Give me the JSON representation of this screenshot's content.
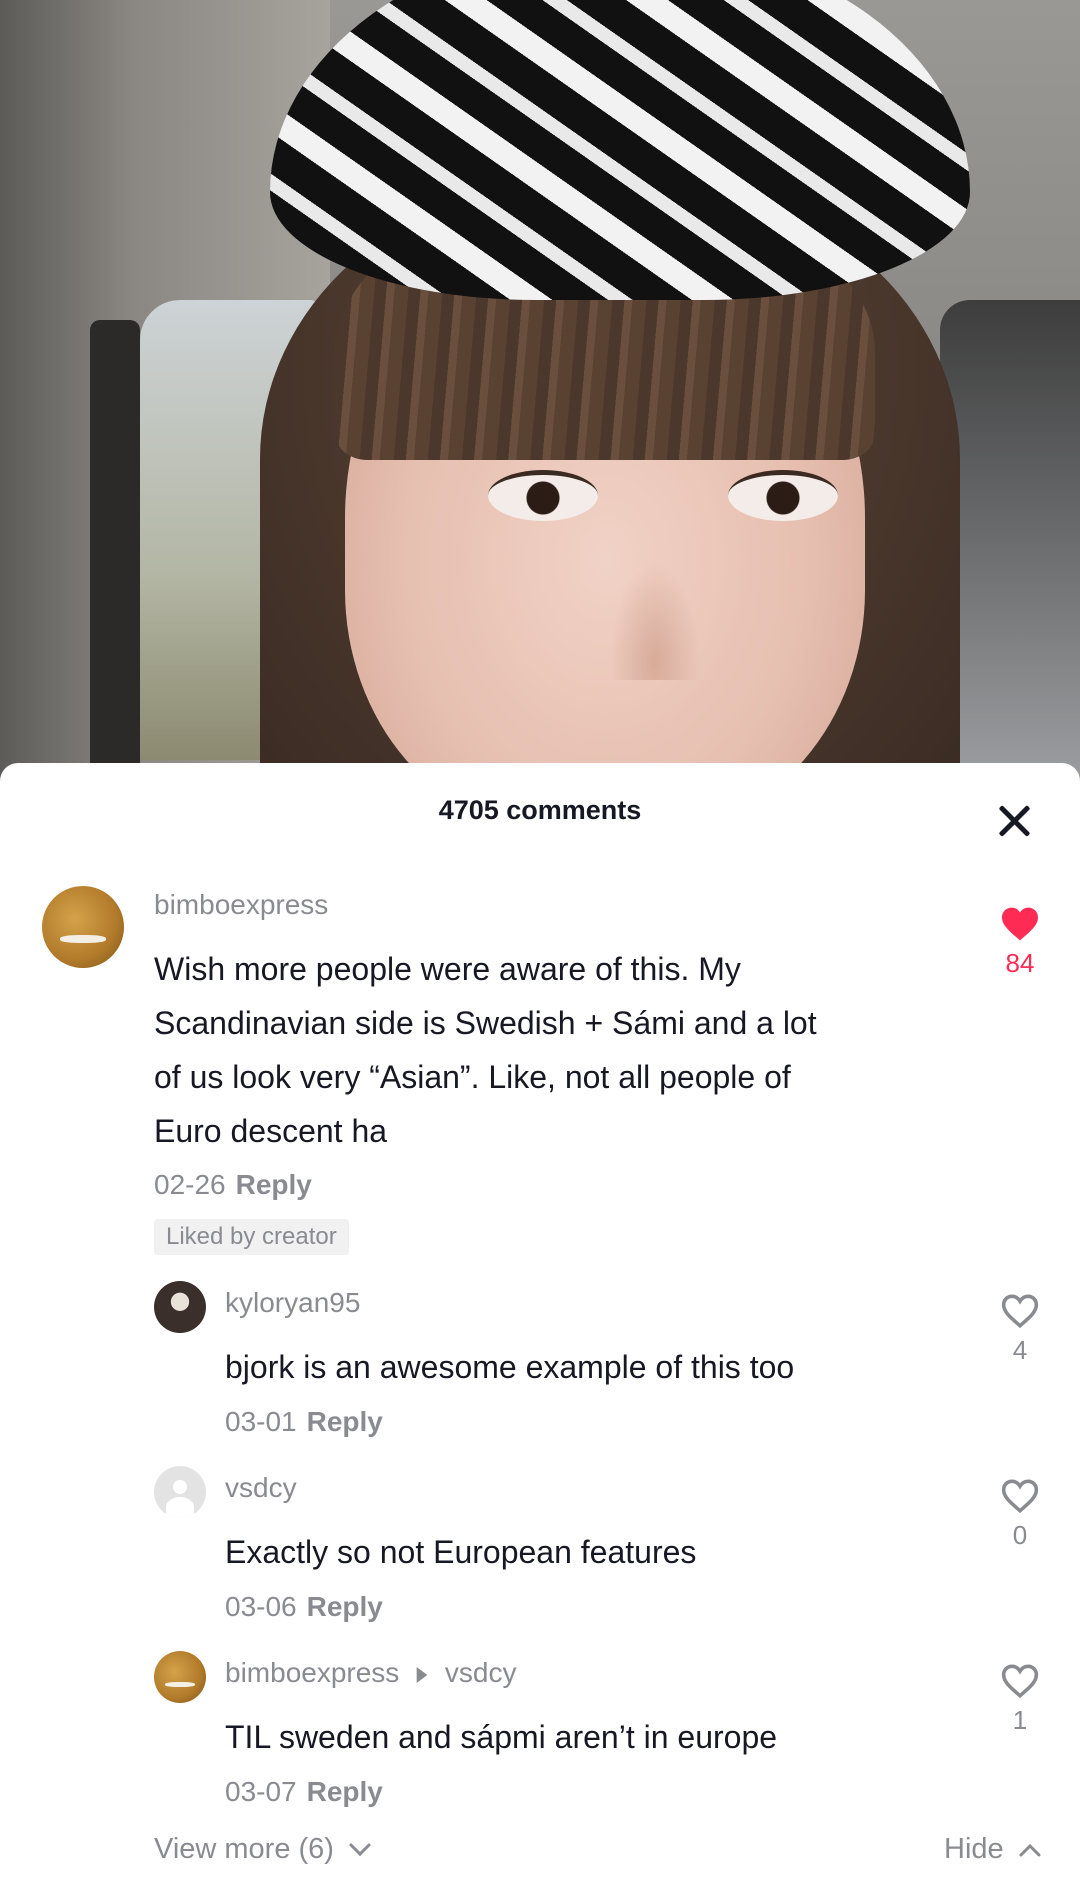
{
  "sheet": {
    "title": "4705 comments"
  },
  "comments": [
    {
      "username": "bimboexpress",
      "text_lines": [
        "Wish more people were aware of this. My",
        "Scandinavian side is Swedish + Sámi and a lot",
        "of us look very “Asian”. Like, not all people of",
        "Euro descent ha"
      ],
      "date": "02-26",
      "reply_label": "Reply",
      "badge": "Liked by creator",
      "like_count": "84",
      "liked": true
    }
  ],
  "replies": [
    {
      "username": "kyloryan95",
      "text": "bjork is an awesome example of this too",
      "date": "03-01",
      "reply_label": "Reply",
      "like_count": "4"
    },
    {
      "username": "vsdcy",
      "text": "Exactly so not European features",
      "date": "03-06",
      "reply_label": "Reply",
      "like_count": "0"
    },
    {
      "username": "bimboexpress",
      "reply_to": "vsdcy",
      "text": "TIL sweden and sápmi aren’t in europe",
      "date": "03-07",
      "reply_label": "Reply",
      "like_count": "1"
    }
  ],
  "footer": {
    "view_more": "View more (6)",
    "hide": "Hide"
  },
  "colors": {
    "like_active": "#fe2c55",
    "text_primary": "#161823",
    "text_secondary": "#8a8b91"
  }
}
